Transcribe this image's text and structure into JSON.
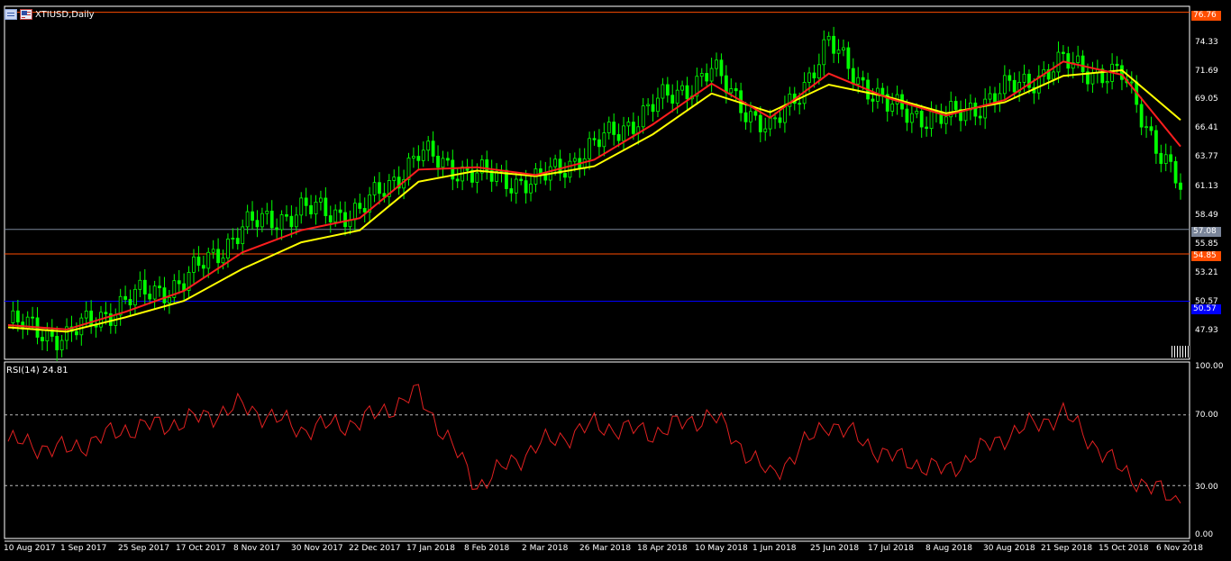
{
  "window": {
    "symbol_title": "XTIUSD,Daily"
  },
  "price_axis": {
    "ticks": [
      "74.33",
      "71.69",
      "69.05",
      "66.41",
      "63.77",
      "61.13",
      "58.49",
      "55.85",
      "53.21",
      "50.57",
      "47.93"
    ]
  },
  "rsi_axis": {
    "ticks": [
      "100.00",
      "70.00",
      "30.00",
      "0.00"
    ]
  },
  "date_axis": [
    "10 Aug 2017",
    "1 Sep 2017",
    "25 Sep 2017",
    "17 Oct 2017",
    "8 Nov 2017",
    "30 Nov 2017",
    "22 Dec 2017",
    "17 Jan 2018",
    "8 Feb 2018",
    "2 Mar 2018",
    "26 Mar 2018",
    "18 Apr 2018",
    "10 May 2018",
    "1 Jun 2018",
    "25 Jun 2018",
    "17 Jul 2018",
    "8 Aug 2018",
    "30 Aug 2018",
    "21 Sep 2018",
    "15 Oct 2018",
    "6 Nov 2018"
  ],
  "price_tags": {
    "resistance": {
      "label": "76.76",
      "color": "#ff4d00"
    },
    "current": {
      "label": "57.08",
      "color": "#7a8599"
    },
    "support": {
      "label": "54.85",
      "color": "#ff4d00"
    },
    "blue_line": {
      "label": "50.57",
      "color": "#0000ff"
    }
  },
  "rsi": {
    "label": "RSI(14) 24.81"
  },
  "chart_data": {
    "type": "line",
    "title": "XTIUSD,Daily",
    "candle_color": "#00ff00",
    "ma_fast_color": "#ff1e1e",
    "ma_slow_color": "#ffff00",
    "rsi_color": "#e02020",
    "price_range": [
      45.3,
      77.3
    ],
    "rsi_range": [
      0,
      100
    ],
    "rsi_levels": [
      70,
      30
    ],
    "horizontal_levels": [
      76.76,
      57.08,
      54.85,
      50.57
    ],
    "x": [
      "10 Aug 2017",
      "1 Sep 2017",
      "25 Sep 2017",
      "17 Oct 2017",
      "8 Nov 2017",
      "30 Nov 2017",
      "22 Dec 2017",
      "17 Jan 2018",
      "8 Feb 2018",
      "2 Mar 2018",
      "26 Mar 2018",
      "18 Apr 2018",
      "10 May 2018",
      "1 Jun 2018",
      "25 Jun 2018",
      "17 Jul 2018",
      "8 Aug 2018",
      "30 Aug 2018",
      "21 Sep 2018",
      "15 Oct 2018",
      "6 Nov 2018"
    ],
    "close": [
      48.6,
      47.3,
      50.6,
      52.3,
      57.2,
      58.8,
      58.6,
      63.9,
      62.0,
      61.3,
      64.6,
      68.2,
      71.4,
      65.8,
      73.8,
      68.1,
      67.0,
      69.6,
      72.1,
      70.9,
      60.7
    ],
    "ma_fast": [
      48.4,
      48.0,
      49.6,
      51.5,
      55.0,
      57.0,
      58.1,
      62.5,
      62.7,
      62.0,
      63.4,
      66.6,
      70.3,
      67.2,
      71.2,
      69.0,
      67.4,
      68.8,
      72.3,
      71.1,
      64.6
    ],
    "ma_slow": [
      48.2,
      47.8,
      49.1,
      50.6,
      53.5,
      55.9,
      57.0,
      61.4,
      62.4,
      61.9,
      62.8,
      65.7,
      69.4,
      67.7,
      70.2,
      69.1,
      67.6,
      68.6,
      71.0,
      71.5,
      67.0
    ],
    "rsi_values": [
      55,
      50,
      62,
      66,
      75,
      62,
      66,
      82,
      30,
      52,
      64,
      60,
      70,
      35,
      66,
      47,
      38,
      58,
      71,
      38,
      20
    ]
  }
}
